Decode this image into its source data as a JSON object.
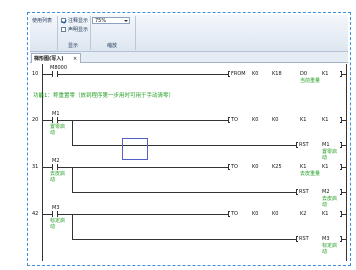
{
  "ribbon": {
    "list_label": "使用列表",
    "show_comment_label": "注释显示",
    "show_comment_checked": true,
    "show_declaration_label": "声明显示",
    "show_declaration_checked": false,
    "zoom_value": "75%",
    "group_display_label": "显示",
    "group_zoom_label": "缩放"
  },
  "tab": {
    "label": "梯形图(写入)",
    "close_label": "×"
  },
  "icons": {
    "checkbox_checked": "check-icon",
    "zoom_dropdown": "chevron-down-icon",
    "contact": "normally-open-contact-icon"
  },
  "colors": {
    "frame_border": "#3d8fe0",
    "comment_text": "#1f9d1f",
    "cursor": "#5060c8",
    "ribbon": "#dde6f0"
  },
  "ladder": {
    "section_comment": "功能1：称重置零（放到程序第一步用时可用于手动清零）",
    "rungs": [
      {
        "step": "10",
        "contact": "M8000",
        "instruction": [
          "FROM",
          "K0",
          "K18",
          "D0",
          "K1"
        ],
        "instruction_comment": "当前重量"
      },
      {
        "step": "20",
        "contact": "M1",
        "contact_comment": [
          "置零启",
          "动"
        ],
        "instruction": [
          "TO",
          "K0",
          "K0",
          "K1",
          "K1"
        ],
        "reset": [
          "RST",
          "M1"
        ],
        "reset_comment": [
          "置零启",
          "动"
        ]
      },
      {
        "step": "31",
        "contact": "M2",
        "contact_comment": [
          "去皮启",
          "动"
        ],
        "instruction": [
          "TO",
          "K0",
          "K25",
          "K1",
          "K1"
        ],
        "instruction_comment": "去皮重量",
        "reset": [
          "RST",
          "M2"
        ],
        "reset_comment": [
          "去皮启",
          "动"
        ]
      },
      {
        "step": "42",
        "contact": "M3",
        "contact_comment": [
          "标定启",
          "动"
        ],
        "instruction": [
          "TO",
          "K0",
          "K0",
          "K2",
          "K1"
        ],
        "reset": [
          "RST",
          "M3"
        ],
        "reset_comment": [
          "标定启",
          "动"
        ]
      }
    ]
  }
}
